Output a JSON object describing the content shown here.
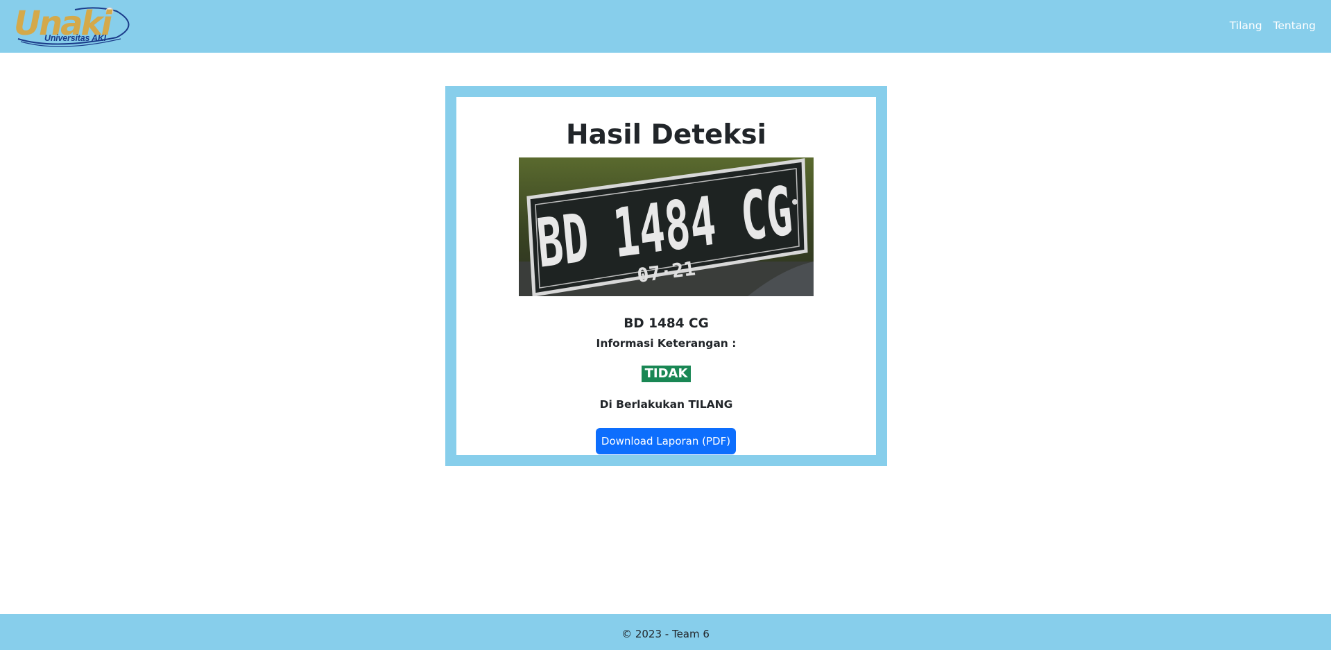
{
  "navbar": {
    "brand_name": "Unaki",
    "brand_subtitle": "Universitas AKI",
    "links": [
      "Tilang",
      "Tentang"
    ]
  },
  "result": {
    "title": "Hasil Deteksi",
    "plate_image": {
      "main_text": "BD 1484 CG",
      "sub_text": "07·21"
    },
    "plate_number": "BD 1484 CG",
    "info_label": "Informasi Keterangan :",
    "status_badge": "TIDAK",
    "status_prefix": "Di Berlakukan",
    "status_emphasis": "TILANG",
    "download_button": "Download Laporan (PDF)"
  },
  "footer": {
    "text": "© 2023 - Team 6"
  },
  "colors": {
    "primary_bg": "#87ceeb",
    "badge_green": "#198754",
    "button_blue": "#0d6efd",
    "brand_gold": "#d4a94a",
    "brand_navy": "#1b3c8a"
  }
}
